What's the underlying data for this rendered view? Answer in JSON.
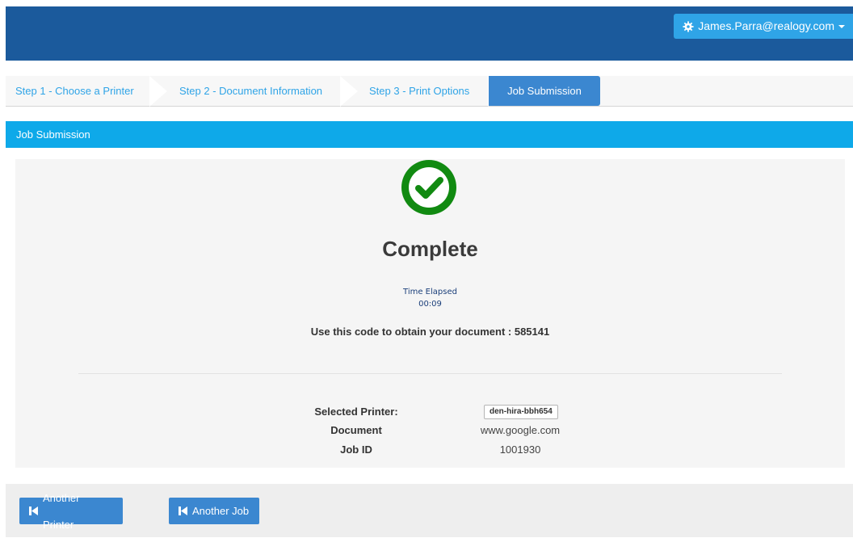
{
  "header": {
    "user_label": "James.Parra@realogy.com"
  },
  "steps": [
    {
      "label": "Step 1 - Choose a Printer"
    },
    {
      "label": "Step 2 - Document Information"
    },
    {
      "label": "Step 3 - Print Options"
    },
    {
      "label": "Job Submission"
    }
  ],
  "section": {
    "title": "Job Submission"
  },
  "result": {
    "status": "Complete",
    "elapsed_label": "Time Elapsed",
    "elapsed_value": "00:09",
    "code_text": "Use this code to obtain your document : 585141"
  },
  "details": {
    "printer_label": "Selected Printer:",
    "printer_value": "den-hira-bbh654",
    "document_label": "Document",
    "document_value": "www.google.com",
    "job_label": "Job ID",
    "job_value": "1001930"
  },
  "footer": {
    "another_printer": "Another Printer",
    "another_job": "Another Job"
  },
  "colors": {
    "header": "#1b5a9c",
    "accent": "#2fa4e7",
    "success": "#118a11",
    "active_step": "#3b87d0"
  },
  "icons": {
    "user_menu": "gear-icon",
    "status": "check-circle-icon",
    "buttons": "step-backward-icon"
  }
}
